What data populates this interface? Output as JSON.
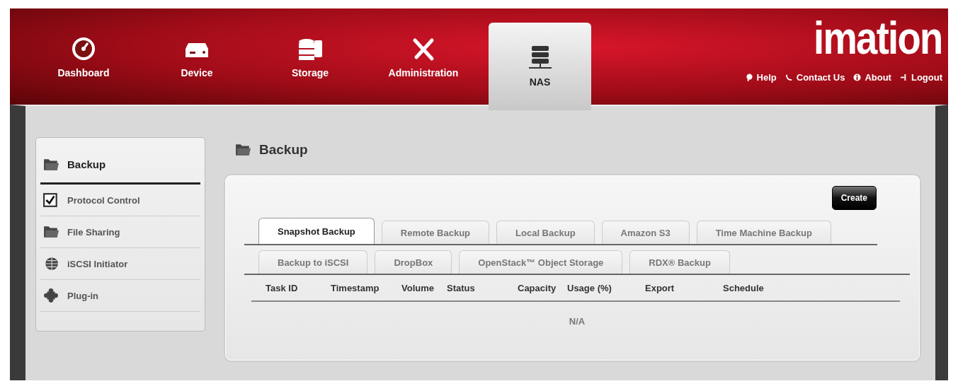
{
  "nav": [
    {
      "label": "Dashboard",
      "selected": false
    },
    {
      "label": "Device",
      "selected": false
    },
    {
      "label": "Storage",
      "selected": false
    },
    {
      "label": "Administration",
      "selected": false
    },
    {
      "label": "NAS",
      "selected": true
    }
  ],
  "brand": "imation",
  "links": [
    "Help",
    "Contact Us",
    "About",
    "Logout"
  ],
  "sidebar": {
    "items": [
      {
        "label": "Backup",
        "selected": true
      },
      {
        "label": "Protocol Control",
        "selected": false
      },
      {
        "label": "File Sharing",
        "selected": false
      },
      {
        "label": "iSCSI Initiator",
        "selected": false
      },
      {
        "label": "Plug-in",
        "selected": false
      }
    ]
  },
  "page_title": "Backup",
  "create_button": "Create",
  "tabs": [
    [
      {
        "label": "Snapshot Backup",
        "selected": true
      },
      {
        "label": "Remote Backup",
        "selected": false
      },
      {
        "label": "Local Backup",
        "selected": false
      },
      {
        "label": "Amazon S3",
        "selected": false
      },
      {
        "label": "Time Machine Backup",
        "selected": false
      }
    ],
    [
      {
        "label": "Backup to iSCSI",
        "selected": false
      },
      {
        "label": "DropBox",
        "selected": false
      },
      {
        "label": "OpenStack™ Object Storage",
        "selected": false
      },
      {
        "label": "RDX® Backup",
        "selected": false
      }
    ]
  ],
  "table": {
    "columns": [
      "Task ID",
      "Timestamp",
      "Volume",
      "Status",
      "Capacity",
      "Usage (%)",
      "Export",
      "Schedule"
    ],
    "empty": "N/A"
  }
}
